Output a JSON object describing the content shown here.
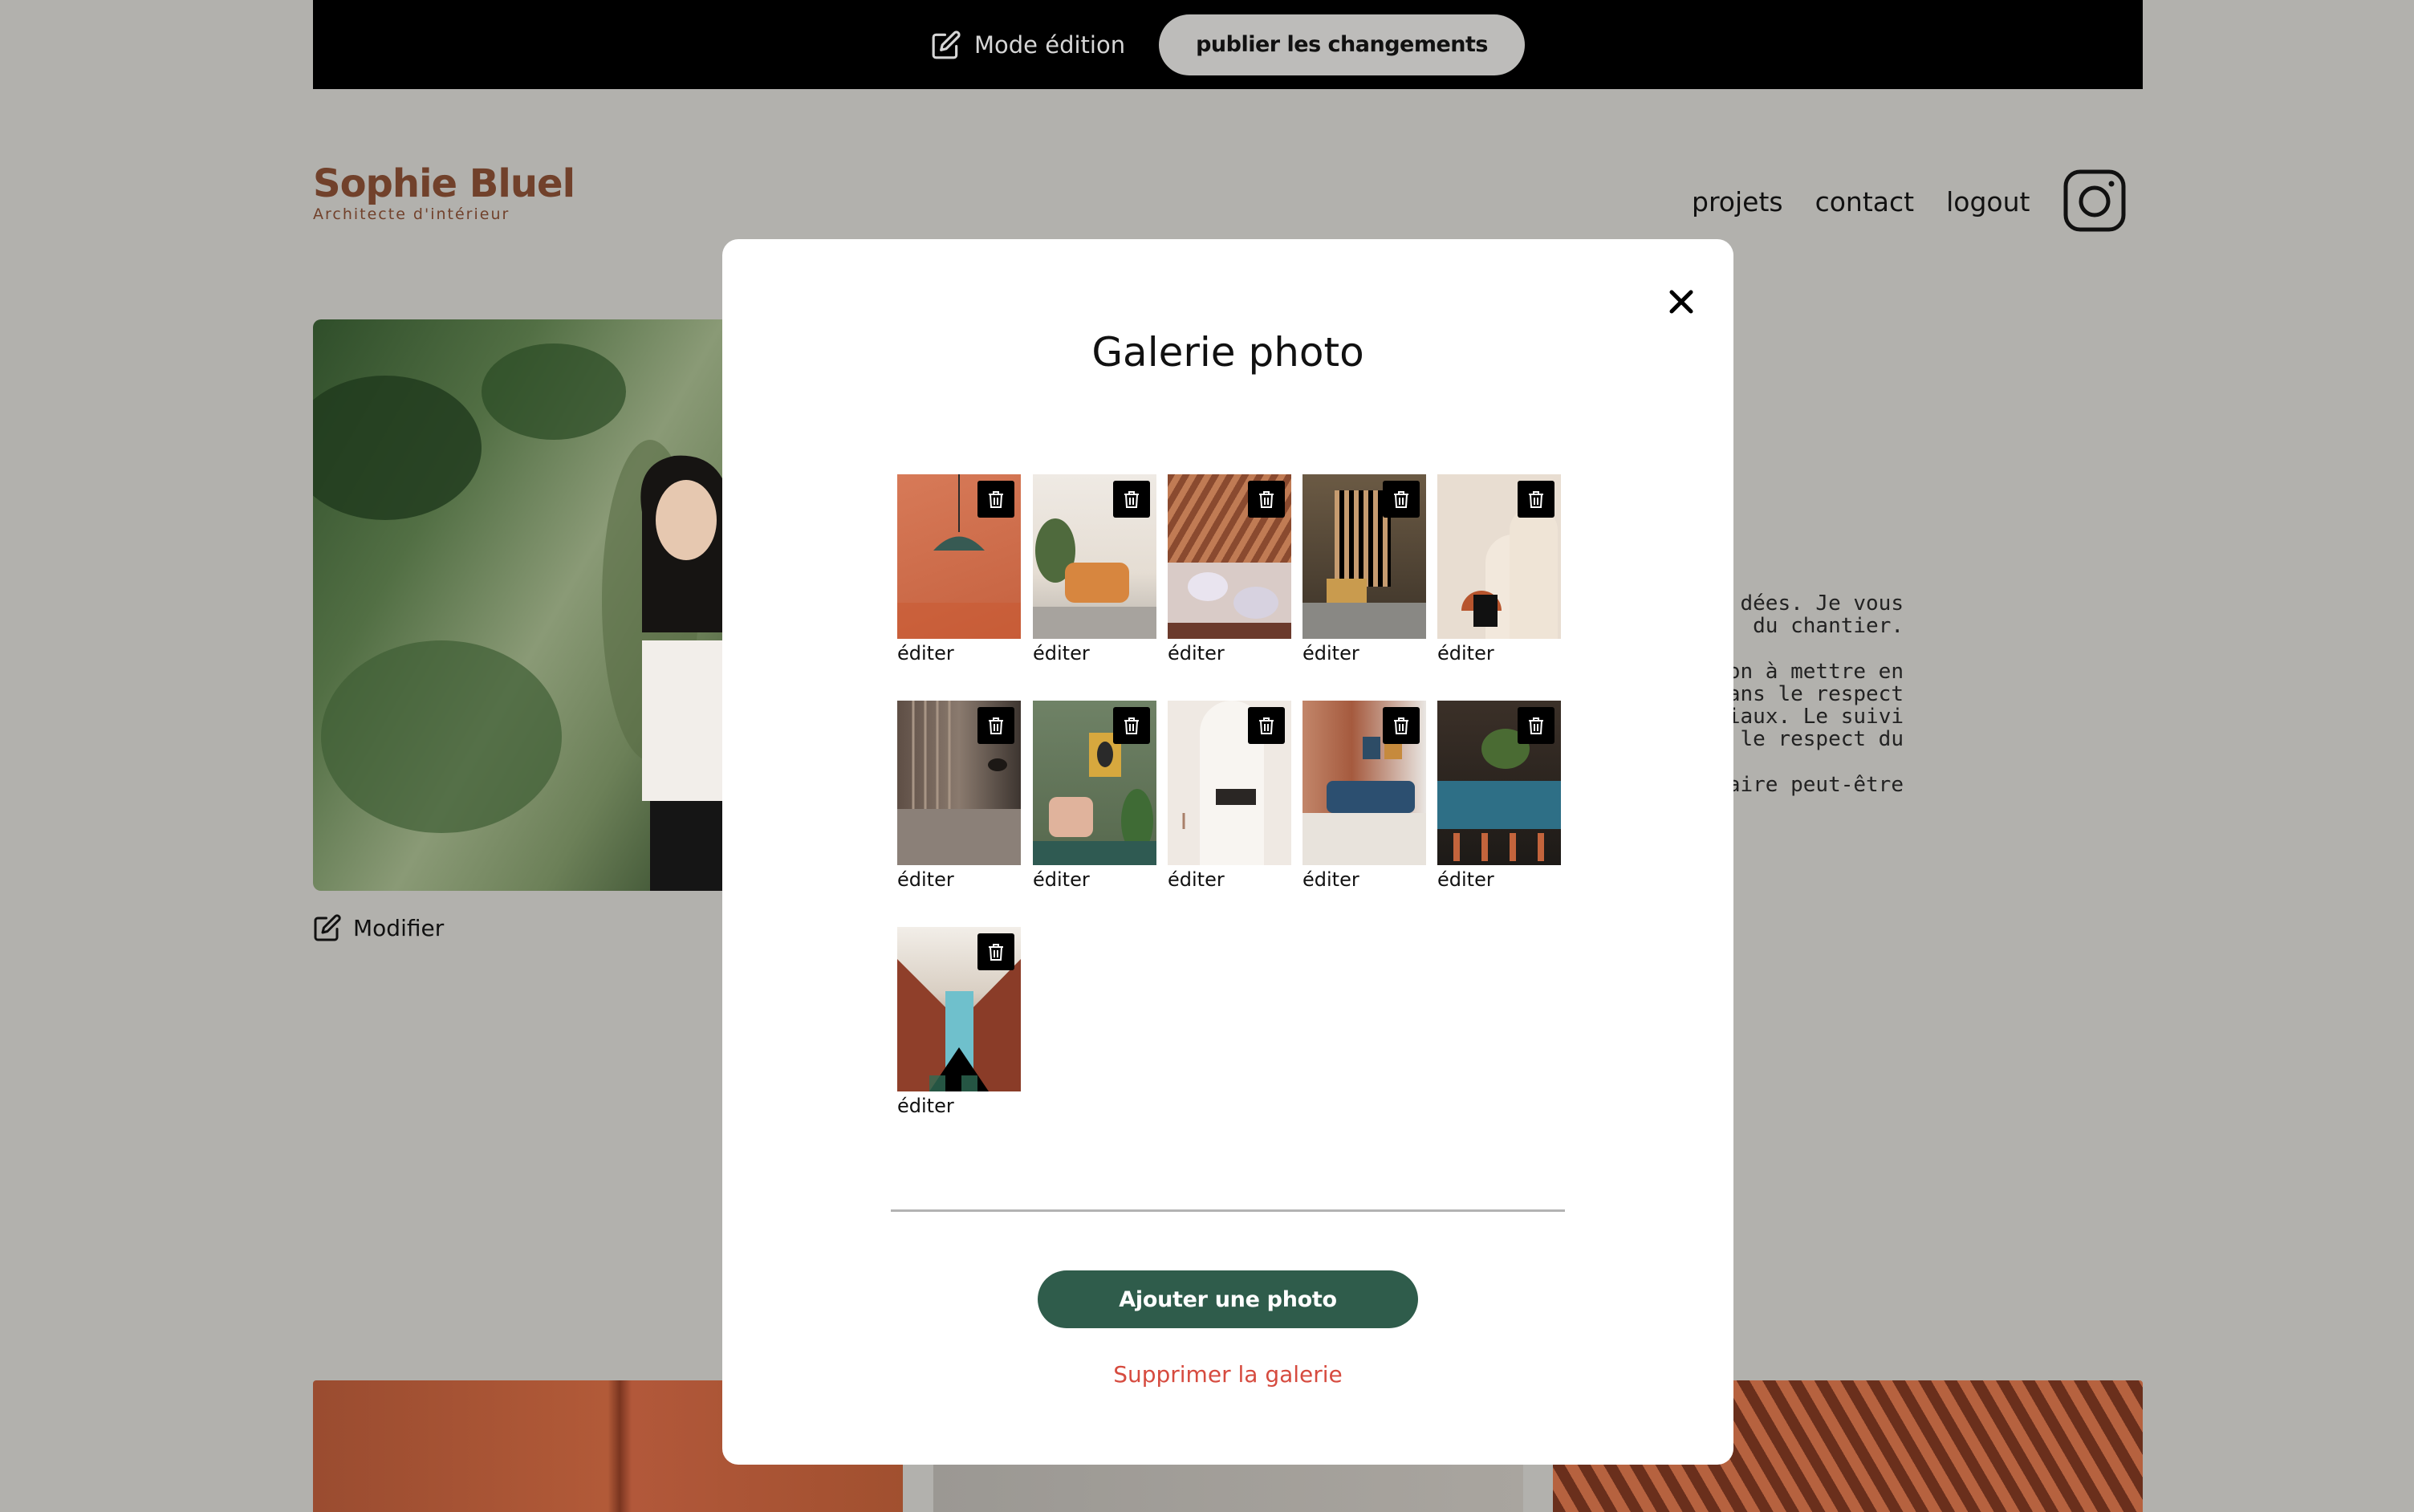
{
  "edit_bar": {
    "mode_label": "Mode édition",
    "publish_label": "publier les changements"
  },
  "header": {
    "logo_title": "Sophie Bluel",
    "logo_subtitle": "Architecte d'intérieur",
    "nav": [
      "projets",
      "contact",
      "logout"
    ],
    "instagram_icon": "instagram-icon"
  },
  "intro": {
    "modify_label": "Modifier",
    "about_lines": [
      "dées. Je vous",
      "du chantier.",
      "on à mettre en",
      "dans le respect",
      "ériaux. Le suivi",
      ", le respect du",
      "naire peut-être"
    ]
  },
  "modal": {
    "title": "Galerie photo",
    "edit_label": "éditer",
    "add_photo_label": "Ajouter une photo",
    "delete_gallery_label": "Supprimer la galerie",
    "close_icon": "close-icon",
    "trash_icon": "trash-icon"
  },
  "colors": {
    "overlay": "#b2b1ad",
    "brand": "#71412b",
    "primary_button": "#2f5c4b",
    "danger_text": "#d64b3f"
  }
}
